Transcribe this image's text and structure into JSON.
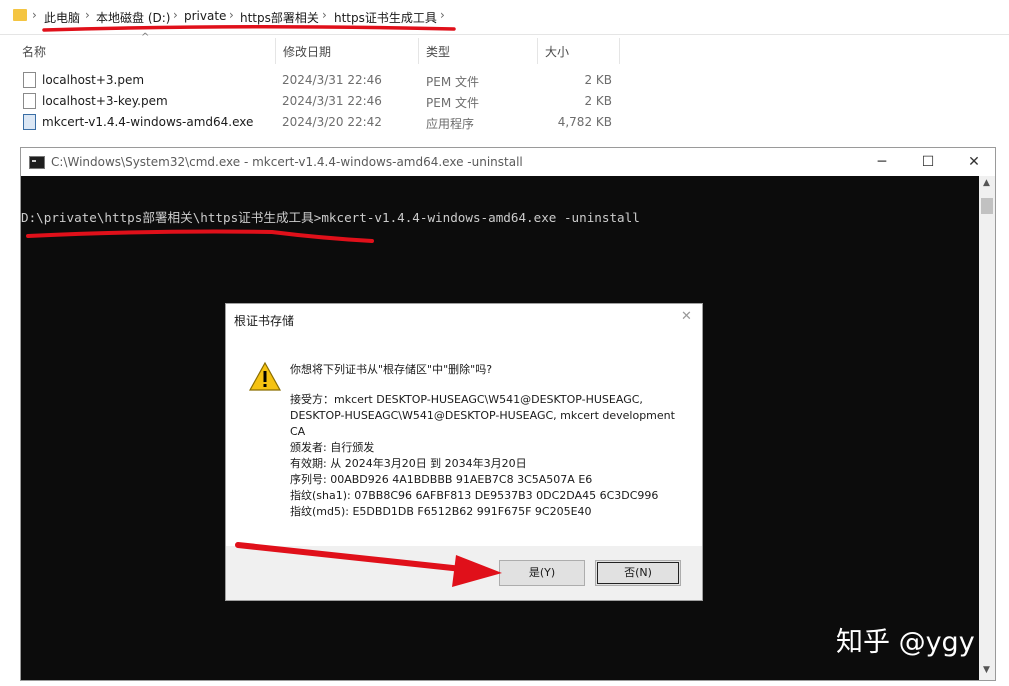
{
  "breadcrumb": [
    "此电脑",
    "本地磁盘 (D:)",
    "private",
    "https部署相关",
    "https证书生成工具"
  ],
  "columns": {
    "name": "名称",
    "modified": "修改日期",
    "type": "类型",
    "size": "大小"
  },
  "files": [
    {
      "name": "localhost+3.pem",
      "modified": "2024/3/31 22:46",
      "type": "PEM 文件",
      "size": "2 KB"
    },
    {
      "name": "localhost+3-key.pem",
      "modified": "2024/3/31 22:46",
      "type": "PEM 文件",
      "size": "2 KB"
    },
    {
      "name": "mkcert-v1.4.4-windows-amd64.exe",
      "modified": "2024/3/20 22:42",
      "type": "应用程序",
      "size": "4,782 KB"
    }
  ],
  "cmd": {
    "title": "C:\\Windows\\System32\\cmd.exe - mkcert-v1.4.4-windows-amd64.exe  -uninstall",
    "line": "D:\\private\\https部署相关\\https证书生成工具>mkcert-v1.4.4-windows-amd64.exe -uninstall"
  },
  "dialog": {
    "title": "根证书存储",
    "question": "你想将下列证书从\"根存储区\"中\"删除\"吗?",
    "lines": [
      "接受方：mkcert DESKTOP-HUSEAGC\\W541@DESKTOP-HUSEAGC,",
      "DESKTOP-HUSEAGC\\W541@DESKTOP-HUSEAGC, mkcert development",
      "CA",
      "颁发者: 自行颁发",
      "有效期: 从 2024年3月20日 到 2034年3月20日",
      "序列号: 00ABD926 4A1BDBBB 91AEB7C8 3C5A507A E6",
      "指纹(sha1): 07BB8C96 6AFBF813 DE9537B3 0DC2DA45 6C3DC996",
      "指纹(md5): E5DBD1DB F6512B62 991F675F 9C205E40"
    ],
    "yes_label": "是(Y)",
    "no_label": "否(N)"
  },
  "watermark": "知乎 @ygy"
}
